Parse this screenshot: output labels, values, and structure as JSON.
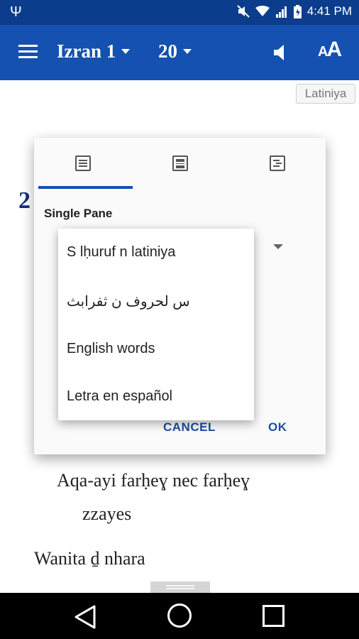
{
  "status_bar": {
    "time": "4:41 PM",
    "icons": [
      "usb-icon",
      "mute-icon",
      "wifi-icon",
      "signal-icon",
      "battery-icon"
    ]
  },
  "app_bar": {
    "book": "Izran 1",
    "chapter": "20",
    "icons": [
      "menu-icon",
      "speaker-icon",
      "text-size-icon"
    ],
    "text_size_label": "AA"
  },
  "content": {
    "script_chip": "Latiniya",
    "verse_number": "2",
    "lines": [
      "Aqa-ayi farḥeɣ nec farḥeɣ",
      "zzayes",
      "Wanita ḏ nhara"
    ]
  },
  "dialog": {
    "tabs": [
      "single-pane-tab",
      "two-pane-tab",
      "verse-by-verse-tab"
    ],
    "section_label": "Single Pane",
    "cancel_label": "CANCEL",
    "ok_label": "OK"
  },
  "dropdown": {
    "items": [
      "S lḥuruf n latiniya",
      "س لحروف ن ثفرابث",
      "English words",
      "Letra en español"
    ]
  },
  "colors": {
    "status_bar": "#0c3d8c",
    "app_bar": "#1451b0",
    "accent": "#1c4ea0",
    "verse_number": "#12307a"
  }
}
